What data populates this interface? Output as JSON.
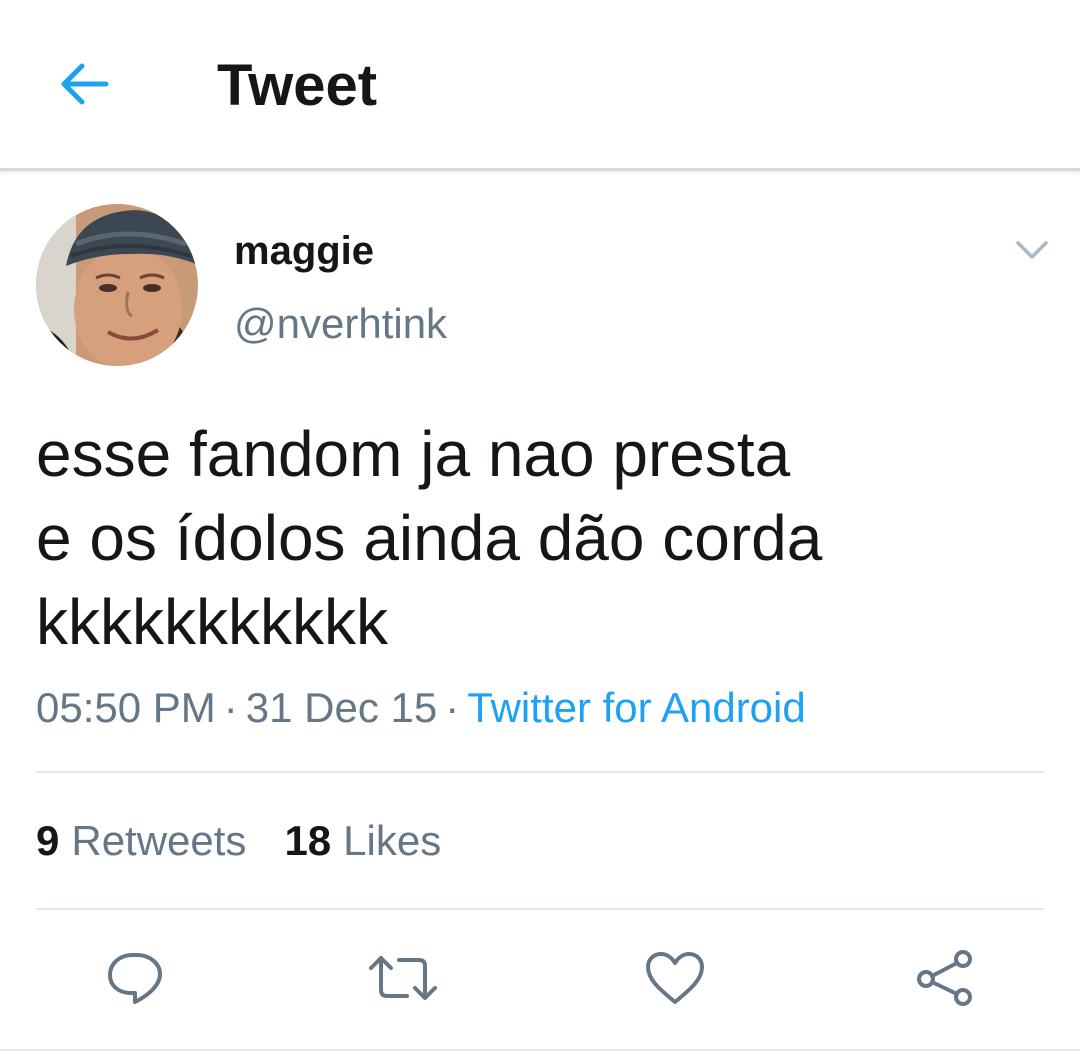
{
  "header": {
    "title": "Tweet",
    "back_icon": "arrow-left-icon"
  },
  "tweet": {
    "author": {
      "display_name": "maggie",
      "handle": "@nverhtink",
      "avatar_icon": "user-avatar"
    },
    "menu_icon": "chevron-down-icon",
    "text_lines": [
      "esse fandom ja nao presta",
      "e os ídolos ainda dão corda",
      "kkkkkkkkkkk"
    ],
    "time": "05:50 PM",
    "separator": "·",
    "date": "31 Dec 15",
    "source": "Twitter for Android",
    "stats": {
      "retweets_count": "9",
      "retweets_label": "Retweets",
      "likes_count": "18",
      "likes_label": "Likes"
    }
  },
  "actions": [
    {
      "icon": "reply-icon"
    },
    {
      "icon": "retweet-icon"
    },
    {
      "icon": "like-icon"
    },
    {
      "icon": "share-icon"
    }
  ],
  "colors": {
    "accent": "#1da1f2",
    "text_primary": "#14171a",
    "text_secondary": "#657786",
    "icon_gray": "#657786",
    "divider": "#e1e8ed"
  }
}
